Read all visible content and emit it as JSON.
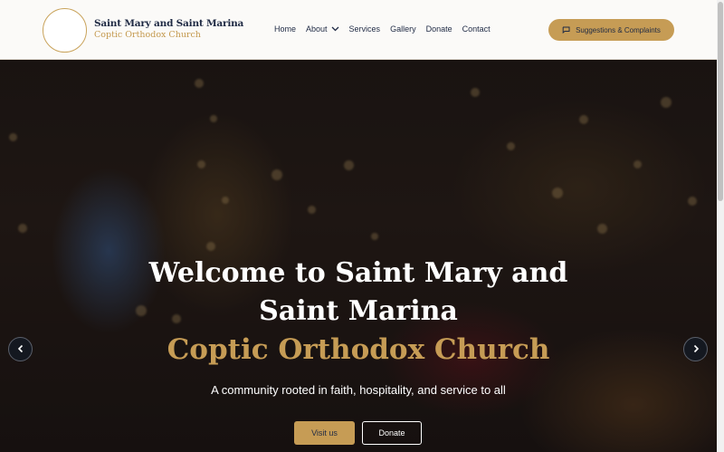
{
  "brand": {
    "name": "Saint Mary and Saint Marina",
    "subtitle": "Coptic Orthodox Church"
  },
  "nav": {
    "items": [
      {
        "label": "Home"
      },
      {
        "label": "About"
      },
      {
        "label": "Services"
      },
      {
        "label": "Gallery"
      },
      {
        "label": "Donate"
      },
      {
        "label": "Contact"
      }
    ],
    "cta_label": "Suggestions & Complaints"
  },
  "hero": {
    "title_line1": "Welcome to Saint Mary and",
    "title_line2": "Saint Marina",
    "accent": "Coptic Orthodox Church",
    "subtitle": "A community rooted in faith, hospitality, and service to all",
    "primary_button": "Visit us",
    "secondary_button": "Donate"
  },
  "icons": {
    "about_dropdown": "chevron-down-icon",
    "cta": "chat-icon",
    "carousel_prev": "chevron-left-icon",
    "carousel_next": "chevron-right-icon"
  },
  "colors": {
    "accent": "#c69c55",
    "navy": "#1f2a44",
    "header_bg": "#fbfaf8"
  }
}
